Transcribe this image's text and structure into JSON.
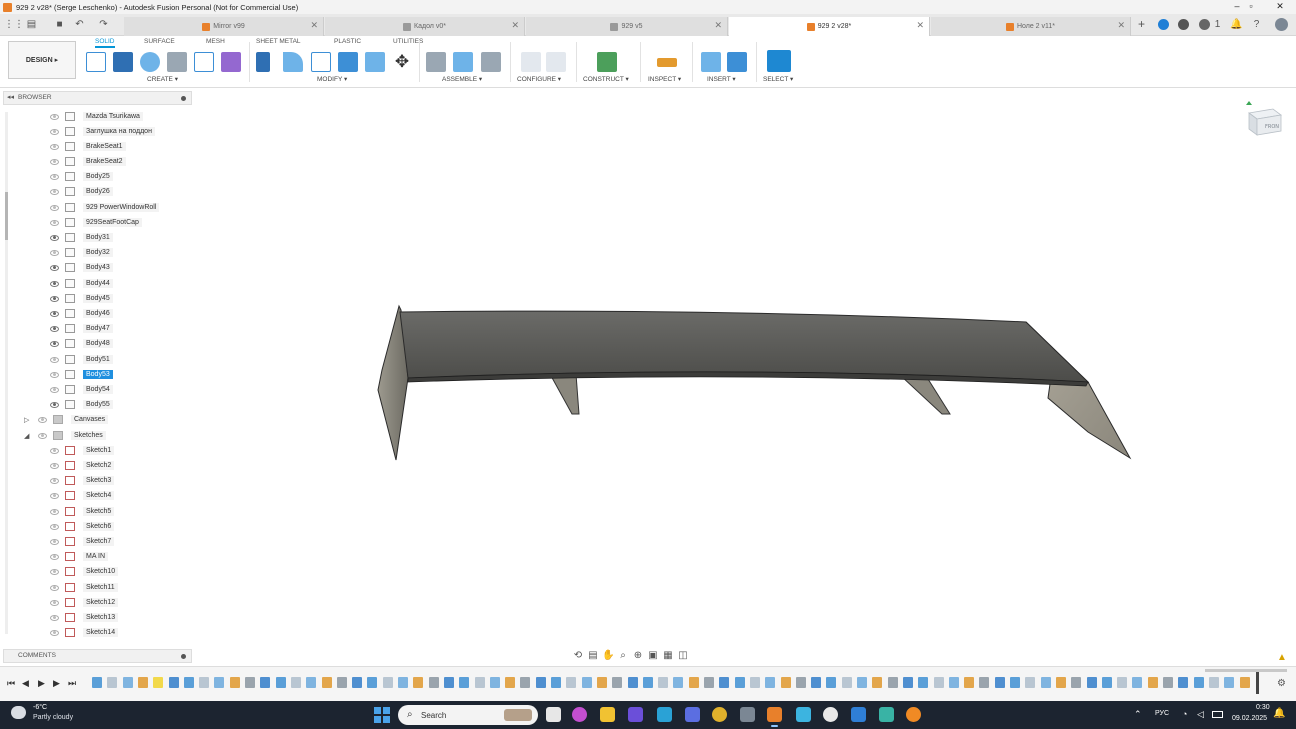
{
  "window": {
    "title": "929 2 v28* (Serge Leschenko) - Autodesk Fusion Personal (Not for Commercial Use)",
    "minimize_icon": "minimize-icon",
    "maximize_icon": "maximize-icon",
    "close_icon": "close-icon"
  },
  "tabs": [
    {
      "label": "Mirror v99",
      "icon": "orange-part"
    },
    {
      "label": "Кадол v0*",
      "icon": "gray-part"
    },
    {
      "label": "929 v5",
      "icon": "gray-part"
    },
    {
      "label": "929 2 v28*",
      "icon": "orange-part",
      "active": true
    },
    {
      "label": "Ноле 2 v11*",
      "icon": "orange-part"
    }
  ],
  "toolbar": {
    "workspace": "DESIGN ▸",
    "workspace_tabs": [
      "SOLID",
      "SURFACE",
      "MESH",
      "SHEET METAL",
      "PLASTIC",
      "UTILITIES"
    ],
    "active_workspace_tab": "SOLID",
    "groups": [
      "CREATE ▾",
      "MODIFY ▾",
      "ASSEMBLE ▾",
      "CONFIGURE ▾",
      "CONSTRUCT ▾",
      "INSPECT ▾",
      "INSERT ▾",
      "SELECT ▾"
    ]
  },
  "browser": {
    "header": "BROWSER",
    "bodies": [
      {
        "label": "Mazda Tsurikawa",
        "visible": false
      },
      {
        "label": "Заглушка на поддон",
        "visible": false
      },
      {
        "label": "BrakeSeat1",
        "visible": false
      },
      {
        "label": "BrakeSeat2",
        "visible": false
      },
      {
        "label": "Body25",
        "visible": false
      },
      {
        "label": "Body26",
        "visible": false
      },
      {
        "label": "929 PowerWindowRoll",
        "visible": false
      },
      {
        "label": "929SeatFootCap",
        "visible": false
      },
      {
        "label": "Body31",
        "visible": true
      },
      {
        "label": "Body32",
        "visible": false
      },
      {
        "label": "Body43",
        "visible": true
      },
      {
        "label": "Body44",
        "visible": true
      },
      {
        "label": "Body45",
        "visible": true
      },
      {
        "label": "Body46",
        "visible": true
      },
      {
        "label": "Body47",
        "visible": true
      },
      {
        "label": "Body48",
        "visible": true
      },
      {
        "label": "Body51",
        "visible": false
      },
      {
        "label": "Body53",
        "visible": false,
        "selected": true
      },
      {
        "label": "Body54",
        "visible": false
      },
      {
        "label": "Body55",
        "visible": true
      }
    ],
    "folders": [
      {
        "label": "Canvases",
        "expanded": false
      },
      {
        "label": "Sketches",
        "expanded": true
      }
    ],
    "sketches": [
      "Sketch1",
      "Sketch2",
      "Sketch3",
      "Sketch4",
      "Sketch5",
      "Sketch6",
      "Sketch7",
      "MA IN",
      "Sketch10",
      "Sketch11",
      "Sketch12",
      "Sketch13",
      "Sketch14"
    ]
  },
  "viewcube": {
    "face_label": "FRON"
  },
  "comments": {
    "header": "COMMENTS"
  },
  "taskbar": {
    "weather_temp": "-6°C",
    "weather_desc": "Partly cloudy",
    "search_placeholder": "Search",
    "language": "РУС",
    "time": "0:30",
    "date": "09.02.2025"
  }
}
